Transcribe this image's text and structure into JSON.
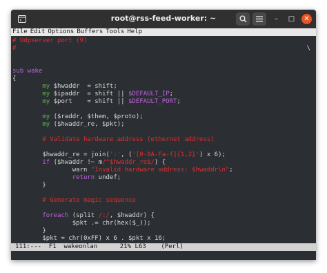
{
  "window": {
    "title": "root@rss-feed-worker: ~",
    "colors": {
      "background": "#2b2f33",
      "titlebar": "#303030",
      "close": "#e95420",
      "comment": "#e02e2e",
      "variable": "#5ab848",
      "keyword": "#c060e0"
    }
  },
  "titlebar": {
    "newtab_icon": "terminal-tab-icon",
    "search_icon": "search-icon",
    "menu_icon": "hamburger-icon",
    "minimize_glyph": "–",
    "maximize_glyph": "□",
    "close_glyph": "✕"
  },
  "menu": {
    "file": "File",
    "edit": "Edit",
    "options": "Options",
    "buffers": "Buffers",
    "tools": "Tools",
    "help": "Help"
  },
  "code": {
    "l1": "# Udpserver port (9)",
    "l2": "#",
    "l2_right": "\\",
    "l5_kw": "sub",
    "l5_name": " wake",
    "l6": "{",
    "l7_a": "        ",
    "l7_my": "my",
    "l7_var": " $hwaddr",
    "l7_rest": "  = shift;",
    "l8_my": "my",
    "l8_var": " $ipaddr",
    "l8_rest": "  = shift || ",
    "l8_const": "$DEFAULT_IP",
    "l8_end": ";",
    "l9_my": "my",
    "l9_var": " $port",
    "l9_rest": "    = shift || ",
    "l9_const": "$DEFAULT_PORT",
    "l9_end": ";",
    "l11_my": "my",
    "l11_rest": " ($raddr, $them, $proto);",
    "l12_my": "my",
    "l12_rest": " ($hwaddr_re, $pkt);",
    "l14": "# Validate hardware address (ethernet address)",
    "l16_a": "$hwaddr_re = join(",
    "l16_b": "':'",
    "l16_c": ", (",
    "l16_d": "'[0-9A-Fa-f]{1,2}'",
    "l16_e": ") x 6);",
    "l17_kw": "if",
    "l17_a": " ($hwaddr !~ m",
    "l17_b": "/^$hwaddr_re$/",
    "l17_c": ") {",
    "l18_a": "warn ",
    "l18_b": "\"Invalid hardware address: $hwaddr\\n\"",
    "l18_c": ";",
    "l19_kw": "return",
    "l19_rest": " undef;",
    "l20": "}",
    "l22": "# Generate magic sequence",
    "l24_kw": "foreach",
    "l24_a": " (split ",
    "l24_b": "/:/",
    "l24_c": ", ",
    "l24_d": "$hwaddr",
    "l24_e": ") {",
    "l25_a": "$pkt",
    "l25_b": " .= chr(hex(",
    "l25_c": "$_",
    "l25_d": "));",
    "l26": "}",
    "l27_a": "$pkt",
    "l27_b": " = chr(0xFF) x 6 . ",
    "l27_c": "$pkt",
    "l27_d": " x 16;"
  },
  "modeline": {
    "flags": "111:---",
    "buffer_num": "F1",
    "filename": "wakeonlan",
    "position": "21% L63",
    "mode": "(Perl)"
  }
}
